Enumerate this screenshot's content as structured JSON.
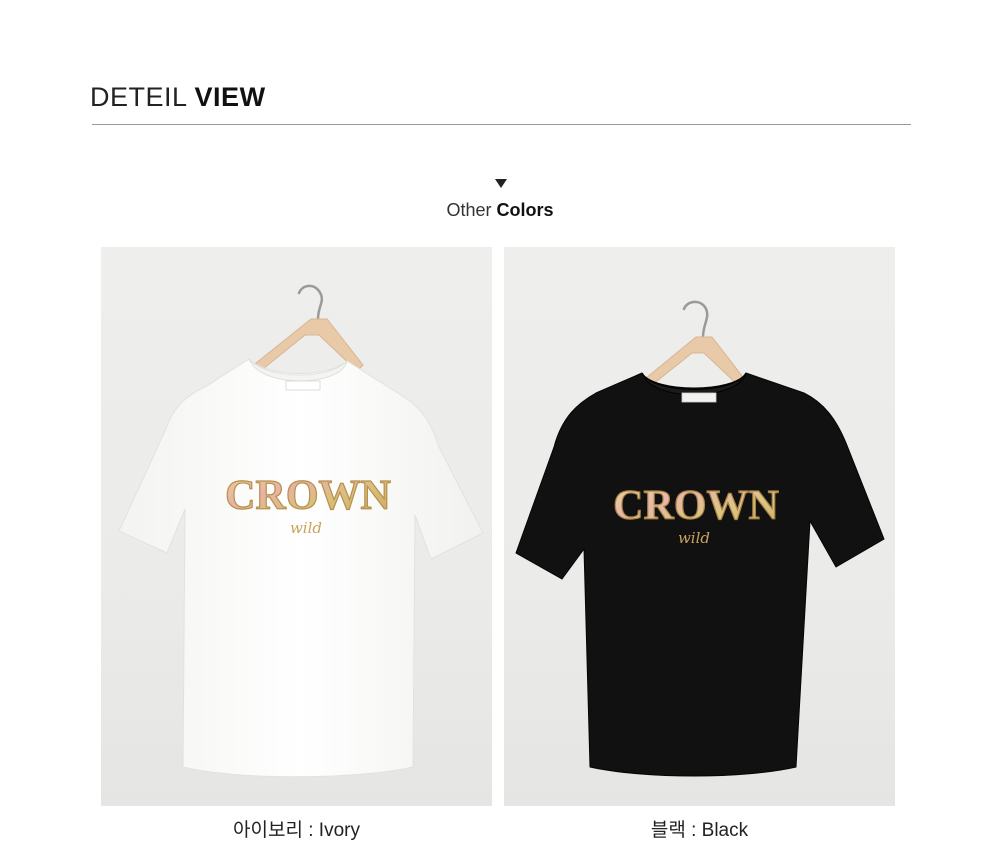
{
  "header": {
    "title_light": "DETEIL",
    "title_bold": "VIEW"
  },
  "other_colors": {
    "label_light": "Other",
    "label_bold": "Colors"
  },
  "products": [
    {
      "color_name": "Ivory",
      "caption": "아이보리 : Ivory",
      "shirt_color": "#fbfbfa",
      "print_word": "CROWN",
      "print_script": "wild"
    },
    {
      "color_name": "Black",
      "caption": "블랙 : Black",
      "shirt_color": "#111111",
      "print_word": "CROWN",
      "print_script": "wild"
    }
  ],
  "colors": {
    "accent_text": "#111111",
    "divider": "#9a9a9a",
    "photo_background": "#ececea",
    "hanger_wood": "#e8c9a8",
    "print_gold": "#d9b56a"
  }
}
